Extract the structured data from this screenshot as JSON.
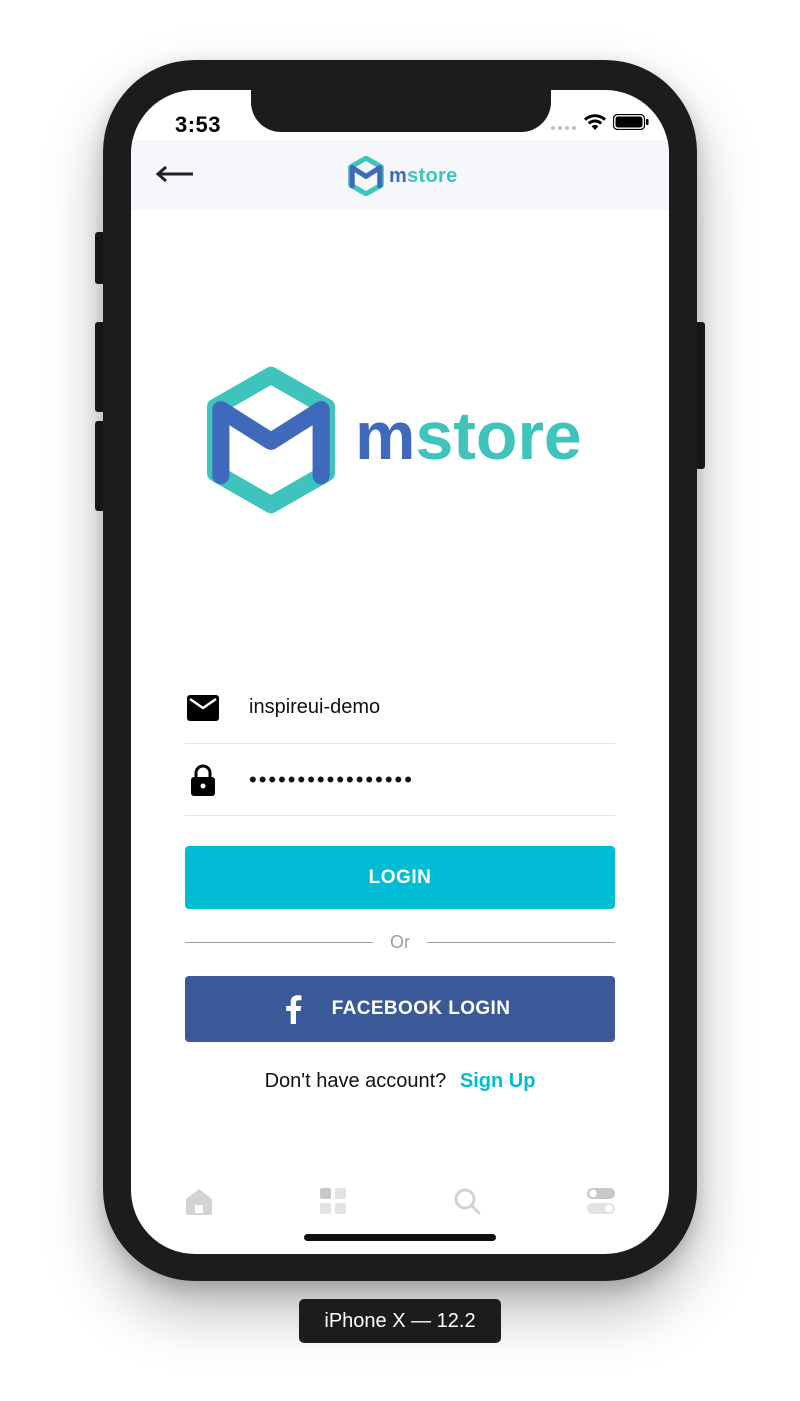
{
  "status_bar": {
    "time": "3:53"
  },
  "nav": {
    "logo_m": "m",
    "logo_rest": "store"
  },
  "brand": {
    "logo_m": "m",
    "logo_rest": "store",
    "color_primary": "#3f6abb",
    "color_secondary": "#3ec4bd"
  },
  "login_form": {
    "username_value": "inspireui-demo",
    "password_value": "•••••••••••••••••",
    "login_button_label": "LOGIN",
    "or_label": "Or",
    "facebook_button_label": "FACEBOOK LOGIN",
    "signup_prompt": "Don't have account?",
    "signup_link": "Sign Up"
  },
  "colors": {
    "accent": "#00bcd4",
    "facebook": "#3b5998"
  },
  "tab_bar": {
    "items": [
      "home-icon",
      "grid-icon",
      "search-icon",
      "settings-toggle-icon"
    ]
  },
  "device_label": "iPhone X — 12.2"
}
